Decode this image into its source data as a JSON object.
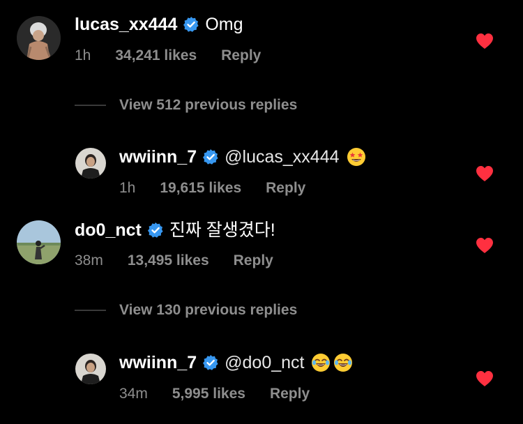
{
  "comments": [
    {
      "username": "lucas_xx444",
      "text": "Omg",
      "time": "1h",
      "likes": "34,241 likes",
      "reply_label": "Reply",
      "liked": true
    },
    {
      "username": "wwiinn_7",
      "text": "@lucas_xx444",
      "emoji": [
        "star-struck-emoji"
      ],
      "time": "1h",
      "likes": "19,615 likes",
      "reply_label": "Reply",
      "liked": true
    },
    {
      "username": "do0_nct",
      "text": "진짜 잘생겼다!",
      "time": "38m",
      "likes": "13,495 likes",
      "reply_label": "Reply",
      "liked": true
    },
    {
      "username": "wwiinn_7",
      "text": "@do0_nct",
      "emoji": [
        "joy-emoji",
        "joy-emoji"
      ],
      "time": "34m",
      "likes": "5,995 likes",
      "reply_label": "Reply",
      "liked": true
    }
  ],
  "view_replies": [
    {
      "label": "View 512 previous replies"
    },
    {
      "label": "View 130 previous replies"
    }
  ],
  "colors": {
    "background": "#000000",
    "secondary_text": "#8e8e8e",
    "verified_blue": "#3797f0",
    "heart_red": "#ff3040"
  }
}
